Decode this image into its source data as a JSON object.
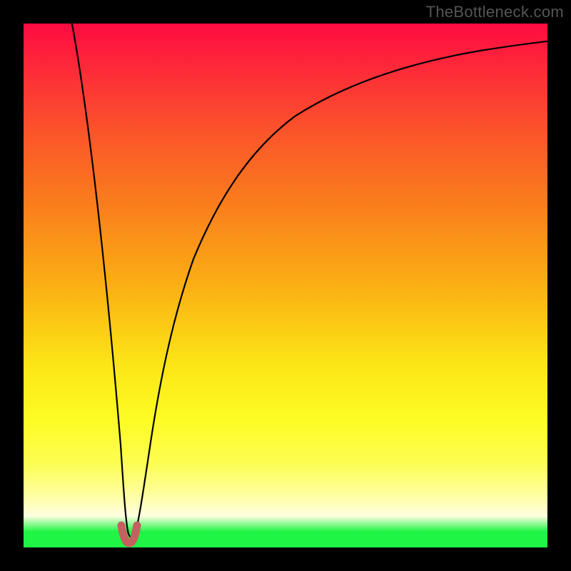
{
  "watermark": "TheBottleneck.com",
  "chart_data": {
    "type": "line",
    "title": "",
    "xlabel": "",
    "ylabel": "",
    "xlim": [
      0,
      100
    ],
    "ylim": [
      0,
      100
    ],
    "background_gradient": {
      "top": "#fe0b41",
      "middle": "#fce516",
      "bottom": "#1ef544"
    },
    "series": [
      {
        "name": "bottleneck-curve",
        "color": "#000000",
        "x": [
          0,
          4,
          8,
          12,
          15,
          17,
          18.5,
          19.5,
          20,
          21,
          22,
          23,
          25,
          27,
          30,
          34,
          38,
          43,
          50,
          58,
          66,
          75,
          85,
          95,
          100
        ],
        "values": [
          104,
          91,
          76,
          58,
          40,
          26,
          13,
          4,
          1,
          1,
          4,
          10,
          22,
          33,
          46,
          58,
          67,
          74,
          81,
          86,
          89.5,
          92,
          94,
          95.5,
          96
        ]
      },
      {
        "name": "minimum-marker",
        "color": "#c85a5a",
        "x": [
          18.8,
          19.3,
          20.0,
          20.7,
          21.2
        ],
        "values": [
          3.5,
          1.2,
          0.8,
          1.2,
          3.5
        ]
      }
    ]
  }
}
